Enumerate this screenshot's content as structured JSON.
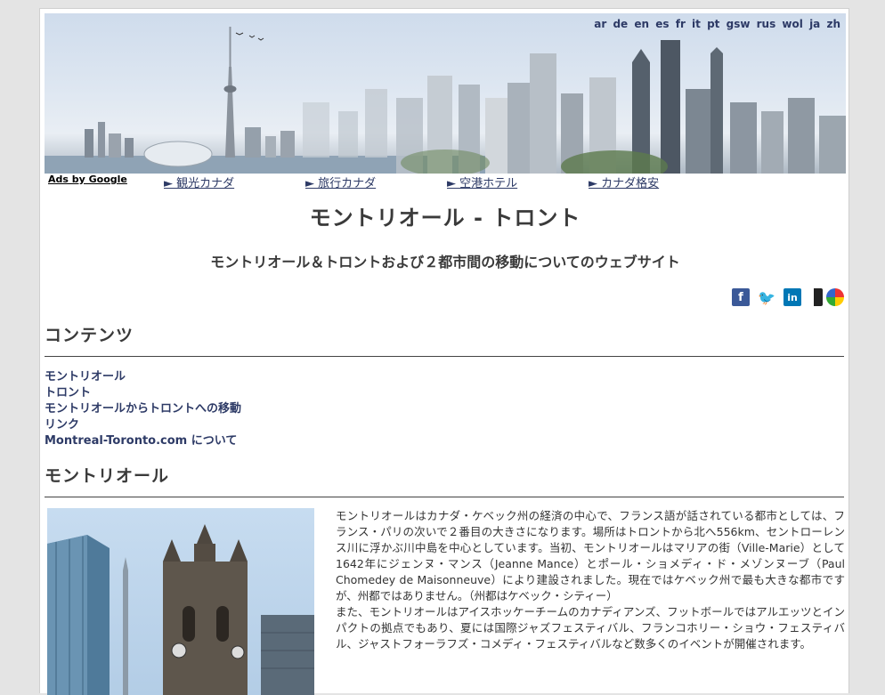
{
  "languages": [
    "ar",
    "de",
    "en",
    "es",
    "fr",
    "it",
    "pt",
    "gsw",
    "rus",
    "wol",
    "ja",
    "zh"
  ],
  "ads": {
    "label": "Ads by Google",
    "links": [
      "► 観光カナダ",
      "► 旅行カナダ",
      "► 空港ホテル",
      "► カナダ格安"
    ]
  },
  "page": {
    "title": "モントリオール - トロント",
    "subtitle": "モントリオール＆トロントおよび２都市間の移動についてのウェブサイト"
  },
  "share_icons": [
    "facebook-icon",
    "twitter-icon",
    "linkedin-icon",
    "delicious-icon",
    "google-buzz-icon"
  ],
  "contents": {
    "heading": "コンテンツ",
    "items": [
      "モントリオール",
      "トロント",
      "モントリオールからトロントへの移動",
      "リンク",
      "Montreal-Toronto.com について"
    ]
  },
  "montreal": {
    "heading": "モントリオール",
    "paragraph1": "モントリオールはカナダ・ケベック州の経済の中心で、フランス語が話されている都市としては、フランス・パリの次いで２番目の大きさになります。場所はトロントから北へ556km、セントローレンス川に浮かぶ川中島を中心としています。当初、モントリオールはマリアの街（Ville-Marie）として1642年にジェンヌ・マンス（Jeanne Mance）とポール・ショメディ・ド・メゾンヌーブ（Paul Chomedey de Maisonneuve）により建設されました。現在ではケベック州で最も大きな都市ですが、州都ではありません。（州都はケベック・シティー）",
    "paragraph2": "また、モントリオールはアイスホッケーチームのカナディアンズ、フットボールではアルエッツとインパクトの拠点でもあり、夏には国際ジャズフェスティバル、フランコホリー・ショウ・フェスティバル、ジャストフォーラフズ・コメディ・フェスティバルなど数多くのイベントが開催されます。"
  },
  "colors": {
    "link": "#2d3a66",
    "heading": "#3a3a3a",
    "background": "#e4e4e4"
  }
}
